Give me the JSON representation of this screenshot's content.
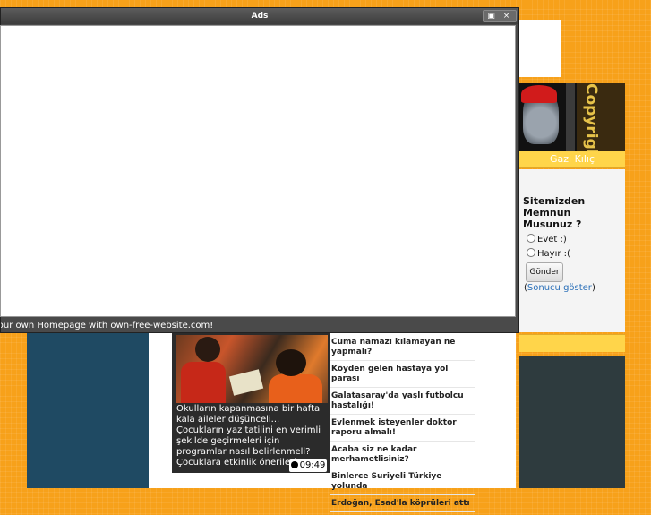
{
  "ads_window": {
    "title": "Ads",
    "controls": [
      "▣",
      "×"
    ],
    "footer": "Your own Homepage with own-free-website.com!"
  },
  "news": {
    "caption": "Okulların kapanmasına bir hafta kala aileler düşünceli... Çocukların yaz tatilini en verimli şekilde geçirmeleri için programlar nasıl belirlenmeli? Çocuklara etkinlik önerileri:",
    "duration": "09:49",
    "headlines": [
      "Cuma namazı kılamayan ne yapmalı?",
      "Köyden gelen hastaya yol parası",
      "Galatasaray'da yaşlı futbolcu hastalığı!",
      "Evlenmek isteyenler doktor raporu almalı!",
      "Acaba siz ne kadar merhametlisiniz?",
      "Binlerce Suriyeli Türkiye yolunda",
      "Erdoğan, Esad'la köprüleri attı"
    ]
  },
  "sidebar": {
    "profile_image_text": "Copyright",
    "user_name": "Gazi Kılıç",
    "poll": {
      "question": "Sitemizden Memnun Musunuz ?",
      "options": [
        "Evet :)",
        "Hayır :("
      ],
      "submit_label": "Gönder",
      "result_prefix": "(",
      "result_link": "Sonucu göster",
      "result_suffix": ")"
    }
  }
}
